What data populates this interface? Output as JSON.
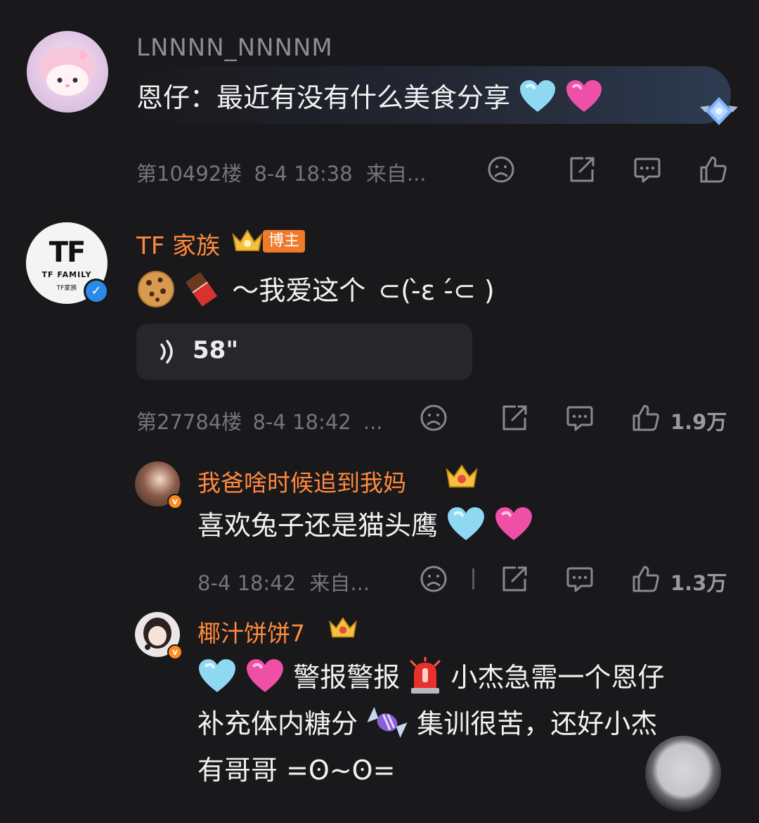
{
  "comment1": {
    "username": "LNNNN_NNNNM",
    "text": "恩仔：最近有没有什么美食分享",
    "floor": "第10492楼",
    "time": "8-4 18:38",
    "source": "来自..."
  },
  "comment2": {
    "username": "TF 家族",
    "badge": "博主",
    "avatar_text_top": "TF",
    "avatar_text_mid": "TF FAMILY",
    "avatar_text_bottom": "TF家族",
    "text": "～我爱这个",
    "kaomoji": "⊂(-̀ε -́⊂ )",
    "voice_duration": "58\"",
    "floor": "第27784楼",
    "time": "8-4 18:42",
    "source": "...",
    "likes": "1.9万"
  },
  "reply1": {
    "username": "我爸啥时候追到我妈",
    "text": "喜欢兔子还是猫头鹰",
    "time": "8-4 18:42",
    "source": "来自...",
    "likes": "1.3万"
  },
  "reply2": {
    "username": "椰汁饼饼7",
    "line1_a": "警报警报",
    "line1_b": "小杰急需一个恩仔",
    "line2_a": "补充体内糖分",
    "line2_b": "集训很苦，还好小杰",
    "line3": "有哥哥 =ʘ~ʘ="
  },
  "colors": {
    "background": "#19181b",
    "username_orange": "#ff8a3d",
    "verified_blue": "#2b8ae8",
    "meta_gray": "#77757a"
  }
}
